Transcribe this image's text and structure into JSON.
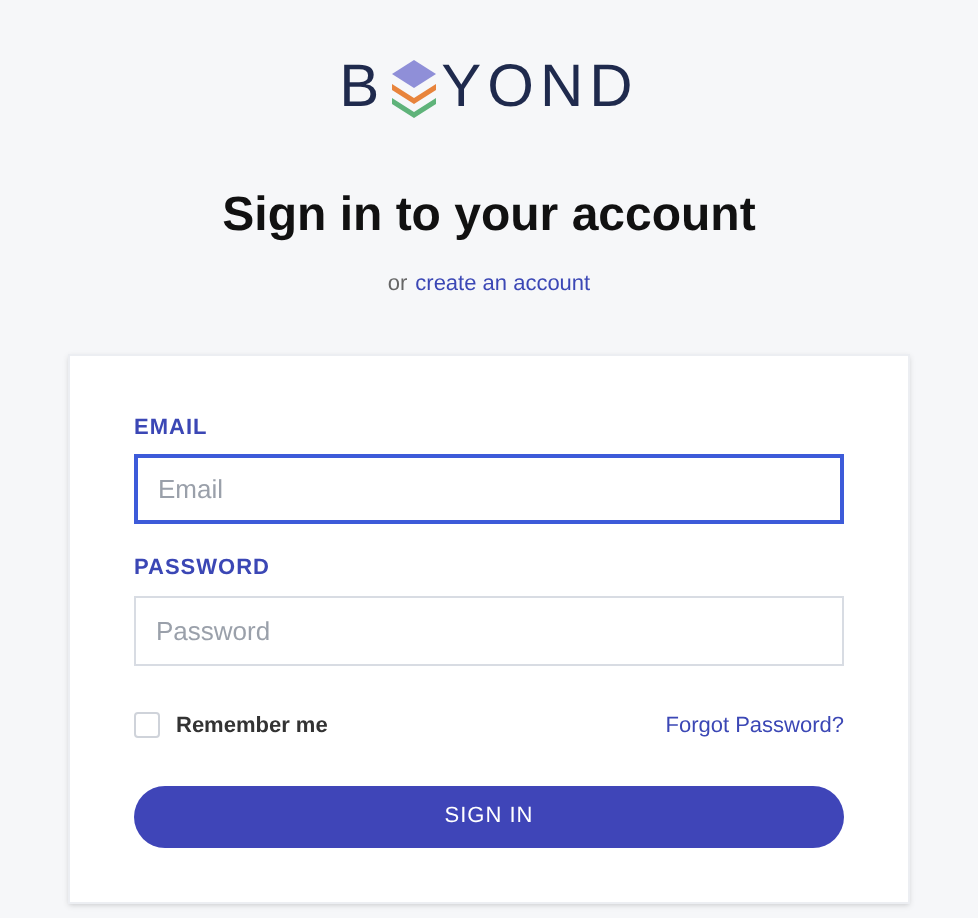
{
  "logo": {
    "before": "B",
    "after": "YOND"
  },
  "heading": "Sign in to your account",
  "subtitle": {
    "prefix": "or",
    "link": "create an account"
  },
  "fields": [
    {
      "label": "EMAIL",
      "placeholder": "Email",
      "focused": true
    },
    {
      "label": "PASSWORD",
      "placeholder": "Password",
      "focused": false
    }
  ],
  "remember": {
    "label": "Remember me",
    "checked": false
  },
  "forgot": "Forgot Password?",
  "submit": "SIGN IN"
}
